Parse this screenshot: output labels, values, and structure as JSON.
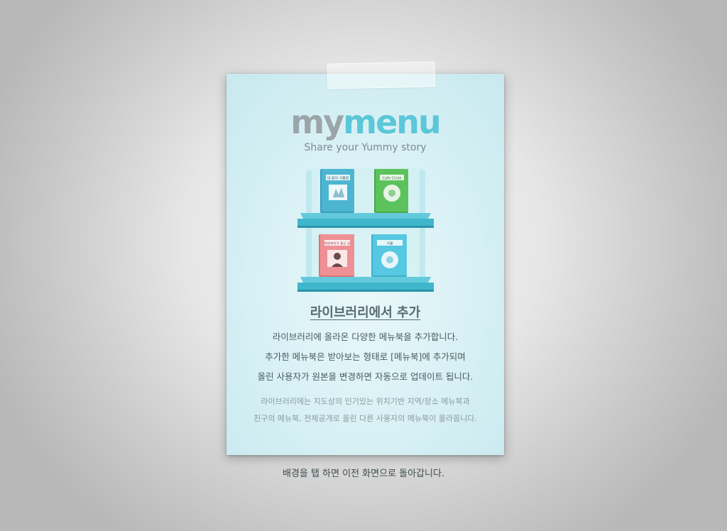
{
  "logo": {
    "my": "my",
    "menu": "menu",
    "tagline": "Share your Yummy story"
  },
  "shelf": {
    "books": [
      {
        "title": "내 꿈의 식물원",
        "color": "#4cb6d2"
      },
      {
        "title": "Cafe Circle",
        "color": "#5cc35c"
      },
      {
        "title": "에덴파리가 좋은 길",
        "color": "#ef8f96"
      },
      {
        "title": "서울",
        "color": "#56c8e2"
      }
    ],
    "shelf_color": "#3fb6cc"
  },
  "heading": "라이브러리에서 추가",
  "description": [
    "라이브러리에 올라온 다양한 메뉴북을 추가합니다.",
    "추가한 메뉴북은 받아보는 형태로 [메뉴북]에 추가되며",
    "올린 사용자가 원본을 변경하면 자동으로 업데이트 됩니다."
  ],
  "note": [
    "라이브러리에는 지도상의 인기있는 위치기반 지역/장소 메뉴북과",
    "친구의 메뉴북, 전체공개로 올린 다른 사용자의 메뉴북이 올라옵니다."
  ],
  "footer": "배경을 탭 하면 이전 화면으로 돌아갑니다."
}
